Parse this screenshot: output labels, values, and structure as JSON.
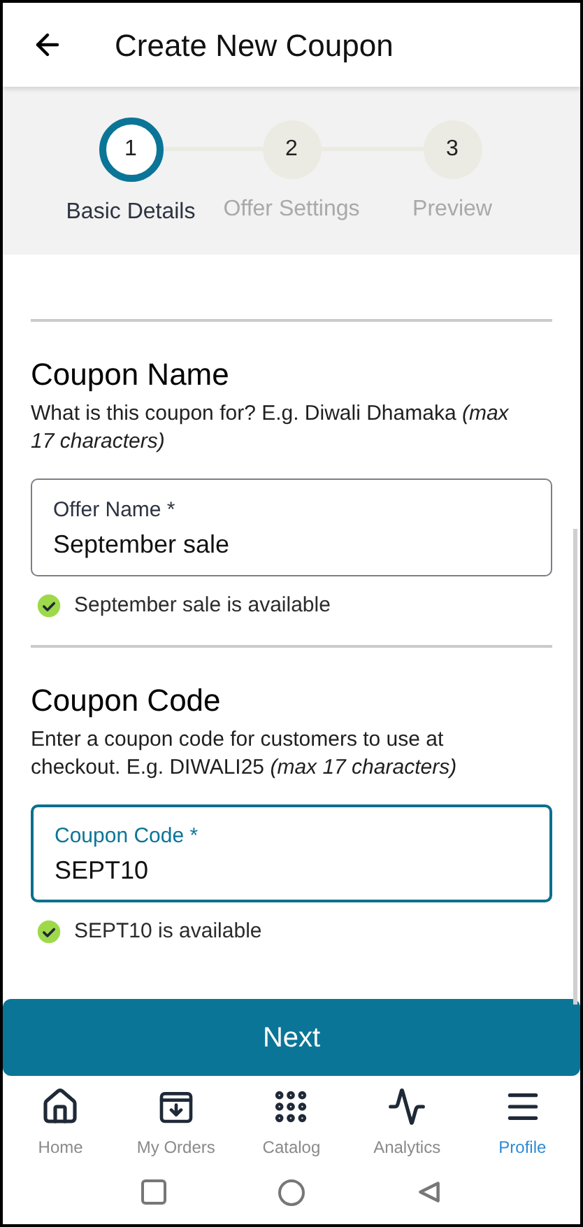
{
  "header": {
    "title": "Create New Coupon"
  },
  "steps": [
    {
      "number": "1",
      "label": "Basic Details",
      "selected": true
    },
    {
      "number": "2",
      "label": "Offer Settings",
      "selected": false
    },
    {
      "number": "3",
      "label": "Preview",
      "selected": false
    }
  ],
  "sections": [
    {
      "heading": "Coupon Name",
      "description": "What is this coupon for? E.g. Diwali Dhamaka *(max 17 characters)*",
      "field": {
        "label": "Offer Name *",
        "value": "September sale",
        "focused": false
      },
      "status": "September sale is available"
    },
    {
      "heading": "Coupon Code",
      "description": "Enter a coupon code for customers to use at checkout. E.g. DIWALI25 *(max 17 characters)*",
      "field": {
        "label": "Coupon Code *",
        "value": "SEPT10",
        "focused": true
      },
      "status": "SEPT10 is available"
    }
  ],
  "primary_button": "Next",
  "bottom_nav": [
    {
      "kind": "home",
      "label": "Home",
      "selected": false
    },
    {
      "kind": "orders",
      "label": "My Orders",
      "selected": false
    },
    {
      "kind": "catalog",
      "label": "Catalog",
      "selected": false
    },
    {
      "kind": "analytics",
      "label": "Analytics",
      "selected": false
    },
    {
      "kind": "profile",
      "label": "Profile",
      "selected": true
    }
  ]
}
